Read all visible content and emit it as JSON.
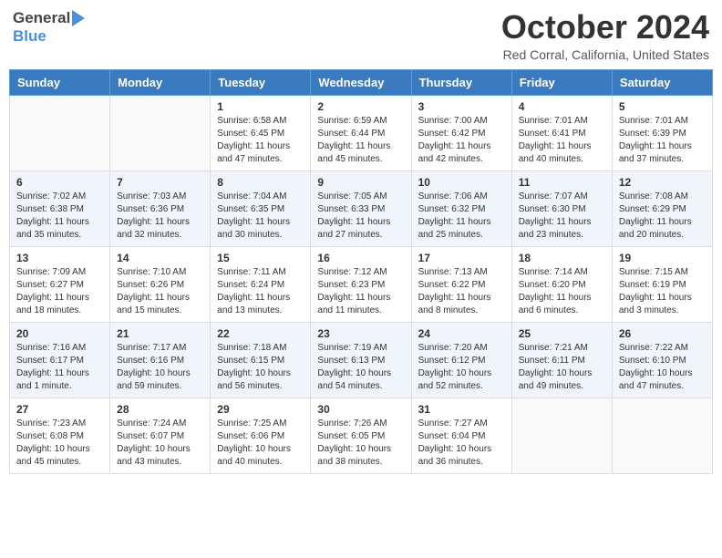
{
  "header": {
    "logo_general": "General",
    "logo_blue": "Blue",
    "month_title": "October 2024",
    "location": "Red Corral, California, United States"
  },
  "calendar": {
    "days_of_week": [
      "Sunday",
      "Monday",
      "Tuesday",
      "Wednesday",
      "Thursday",
      "Friday",
      "Saturday"
    ],
    "weeks": [
      [
        {
          "day": "",
          "sunrise": "",
          "sunset": "",
          "daylight": ""
        },
        {
          "day": "",
          "sunrise": "",
          "sunset": "",
          "daylight": ""
        },
        {
          "day": "1",
          "sunrise": "Sunrise: 6:58 AM",
          "sunset": "Sunset: 6:45 PM",
          "daylight": "Daylight: 11 hours and 47 minutes."
        },
        {
          "day": "2",
          "sunrise": "Sunrise: 6:59 AM",
          "sunset": "Sunset: 6:44 PM",
          "daylight": "Daylight: 11 hours and 45 minutes."
        },
        {
          "day": "3",
          "sunrise": "Sunrise: 7:00 AM",
          "sunset": "Sunset: 6:42 PM",
          "daylight": "Daylight: 11 hours and 42 minutes."
        },
        {
          "day": "4",
          "sunrise": "Sunrise: 7:01 AM",
          "sunset": "Sunset: 6:41 PM",
          "daylight": "Daylight: 11 hours and 40 minutes."
        },
        {
          "day": "5",
          "sunrise": "Sunrise: 7:01 AM",
          "sunset": "Sunset: 6:39 PM",
          "daylight": "Daylight: 11 hours and 37 minutes."
        }
      ],
      [
        {
          "day": "6",
          "sunrise": "Sunrise: 7:02 AM",
          "sunset": "Sunset: 6:38 PM",
          "daylight": "Daylight: 11 hours and 35 minutes."
        },
        {
          "day": "7",
          "sunrise": "Sunrise: 7:03 AM",
          "sunset": "Sunset: 6:36 PM",
          "daylight": "Daylight: 11 hours and 32 minutes."
        },
        {
          "day": "8",
          "sunrise": "Sunrise: 7:04 AM",
          "sunset": "Sunset: 6:35 PM",
          "daylight": "Daylight: 11 hours and 30 minutes."
        },
        {
          "day": "9",
          "sunrise": "Sunrise: 7:05 AM",
          "sunset": "Sunset: 6:33 PM",
          "daylight": "Daylight: 11 hours and 27 minutes."
        },
        {
          "day": "10",
          "sunrise": "Sunrise: 7:06 AM",
          "sunset": "Sunset: 6:32 PM",
          "daylight": "Daylight: 11 hours and 25 minutes."
        },
        {
          "day": "11",
          "sunrise": "Sunrise: 7:07 AM",
          "sunset": "Sunset: 6:30 PM",
          "daylight": "Daylight: 11 hours and 23 minutes."
        },
        {
          "day": "12",
          "sunrise": "Sunrise: 7:08 AM",
          "sunset": "Sunset: 6:29 PM",
          "daylight": "Daylight: 11 hours and 20 minutes."
        }
      ],
      [
        {
          "day": "13",
          "sunrise": "Sunrise: 7:09 AM",
          "sunset": "Sunset: 6:27 PM",
          "daylight": "Daylight: 11 hours and 18 minutes."
        },
        {
          "day": "14",
          "sunrise": "Sunrise: 7:10 AM",
          "sunset": "Sunset: 6:26 PM",
          "daylight": "Daylight: 11 hours and 15 minutes."
        },
        {
          "day": "15",
          "sunrise": "Sunrise: 7:11 AM",
          "sunset": "Sunset: 6:24 PM",
          "daylight": "Daylight: 11 hours and 13 minutes."
        },
        {
          "day": "16",
          "sunrise": "Sunrise: 7:12 AM",
          "sunset": "Sunset: 6:23 PM",
          "daylight": "Daylight: 11 hours and 11 minutes."
        },
        {
          "day": "17",
          "sunrise": "Sunrise: 7:13 AM",
          "sunset": "Sunset: 6:22 PM",
          "daylight": "Daylight: 11 hours and 8 minutes."
        },
        {
          "day": "18",
          "sunrise": "Sunrise: 7:14 AM",
          "sunset": "Sunset: 6:20 PM",
          "daylight": "Daylight: 11 hours and 6 minutes."
        },
        {
          "day": "19",
          "sunrise": "Sunrise: 7:15 AM",
          "sunset": "Sunset: 6:19 PM",
          "daylight": "Daylight: 11 hours and 3 minutes."
        }
      ],
      [
        {
          "day": "20",
          "sunrise": "Sunrise: 7:16 AM",
          "sunset": "Sunset: 6:17 PM",
          "daylight": "Daylight: 11 hours and 1 minute."
        },
        {
          "day": "21",
          "sunrise": "Sunrise: 7:17 AM",
          "sunset": "Sunset: 6:16 PM",
          "daylight": "Daylight: 10 hours and 59 minutes."
        },
        {
          "day": "22",
          "sunrise": "Sunrise: 7:18 AM",
          "sunset": "Sunset: 6:15 PM",
          "daylight": "Daylight: 10 hours and 56 minutes."
        },
        {
          "day": "23",
          "sunrise": "Sunrise: 7:19 AM",
          "sunset": "Sunset: 6:13 PM",
          "daylight": "Daylight: 10 hours and 54 minutes."
        },
        {
          "day": "24",
          "sunrise": "Sunrise: 7:20 AM",
          "sunset": "Sunset: 6:12 PM",
          "daylight": "Daylight: 10 hours and 52 minutes."
        },
        {
          "day": "25",
          "sunrise": "Sunrise: 7:21 AM",
          "sunset": "Sunset: 6:11 PM",
          "daylight": "Daylight: 10 hours and 49 minutes."
        },
        {
          "day": "26",
          "sunrise": "Sunrise: 7:22 AM",
          "sunset": "Sunset: 6:10 PM",
          "daylight": "Daylight: 10 hours and 47 minutes."
        }
      ],
      [
        {
          "day": "27",
          "sunrise": "Sunrise: 7:23 AM",
          "sunset": "Sunset: 6:08 PM",
          "daylight": "Daylight: 10 hours and 45 minutes."
        },
        {
          "day": "28",
          "sunrise": "Sunrise: 7:24 AM",
          "sunset": "Sunset: 6:07 PM",
          "daylight": "Daylight: 10 hours and 43 minutes."
        },
        {
          "day": "29",
          "sunrise": "Sunrise: 7:25 AM",
          "sunset": "Sunset: 6:06 PM",
          "daylight": "Daylight: 10 hours and 40 minutes."
        },
        {
          "day": "30",
          "sunrise": "Sunrise: 7:26 AM",
          "sunset": "Sunset: 6:05 PM",
          "daylight": "Daylight: 10 hours and 38 minutes."
        },
        {
          "day": "31",
          "sunrise": "Sunrise: 7:27 AM",
          "sunset": "Sunset: 6:04 PM",
          "daylight": "Daylight: 10 hours and 36 minutes."
        },
        {
          "day": "",
          "sunrise": "",
          "sunset": "",
          "daylight": ""
        },
        {
          "day": "",
          "sunrise": "",
          "sunset": "",
          "daylight": ""
        }
      ]
    ]
  }
}
